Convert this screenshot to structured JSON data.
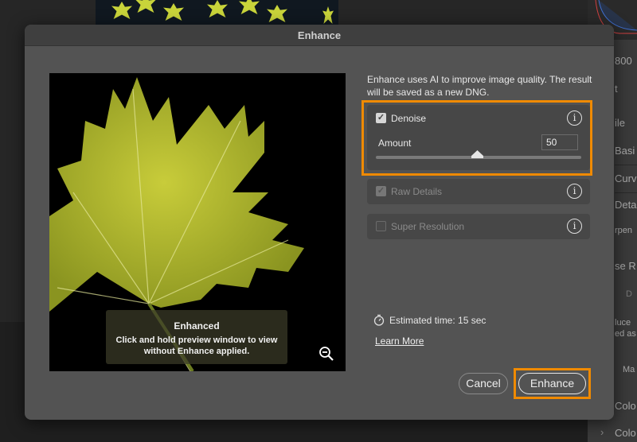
{
  "background_panel": {
    "items": [
      "800",
      "t",
      "ile",
      "Basi",
      "Curv",
      "Deta",
      "rpen",
      "se R",
      "D",
      "luce",
      "ed as",
      "Ma",
      "Colo",
      "Colo"
    ]
  },
  "dialog": {
    "title": "Enhance",
    "preview": {
      "overlay_title": "Enhanced",
      "overlay_text": "Click and hold preview window to view without Enhance applied."
    },
    "description": "Enhance uses AI to improve image quality. The result will be saved as a new DNG.",
    "options": [
      {
        "label": "Denoise",
        "checked": true,
        "enabled": true,
        "highlighted": true
      },
      {
        "label": "Raw Details",
        "checked": true,
        "enabled": false
      },
      {
        "label": "Super Resolution",
        "checked": false,
        "enabled": false
      }
    ],
    "amount": {
      "label": "Amount",
      "value": "50",
      "slider_percent": 50
    },
    "estimated_time": "Estimated time: 15 sec",
    "learn_more": "Learn More",
    "cancel_label": "Cancel",
    "enhance_label": "Enhance",
    "highlight_color": "#f08a00"
  }
}
